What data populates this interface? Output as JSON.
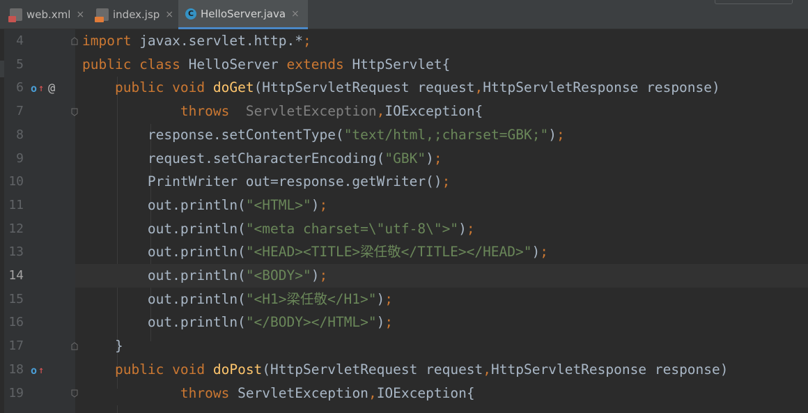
{
  "tabs": [
    {
      "label": "web.xml",
      "icon": "xml-file-icon",
      "active": false
    },
    {
      "label": "index.jsp",
      "icon": "jsp-file-icon",
      "active": false
    },
    {
      "label": "HelloServer.java",
      "icon": "java-class-icon",
      "icon_glyph": "C",
      "active": true
    }
  ],
  "close_glyph": "×",
  "gutter_icons": {
    "override": "o",
    "up_arrow": "↑",
    "annotation": "@"
  },
  "lines": [
    {
      "num": "4",
      "tokens": [
        [
          "kw",
          "import"
        ],
        [
          "t",
          " javax.servlet.http.*"
        ],
        [
          "kw",
          ";"
        ]
      ]
    },
    {
      "num": "5",
      "tokens": [
        [
          "kw",
          "public class"
        ],
        [
          "t",
          " HelloServer "
        ],
        [
          "kw",
          "extends"
        ],
        [
          "t",
          " HttpServlet{"
        ]
      ]
    },
    {
      "num": "6",
      "tokens": [
        [
          "t",
          "    "
        ],
        [
          "kw",
          "public void"
        ],
        [
          "t",
          " "
        ],
        [
          "fn",
          "doGet"
        ],
        [
          "t",
          "(HttpServletRequest request"
        ],
        [
          "kw",
          ","
        ],
        [
          "t",
          "HttpServletResponse response)"
        ]
      ]
    },
    {
      "num": "7",
      "tokens": [
        [
          "t",
          "            "
        ],
        [
          "kw",
          "throws"
        ],
        [
          "t",
          "  "
        ],
        [
          "dim",
          "ServletException"
        ],
        [
          "kw",
          ","
        ],
        [
          "t",
          "IOException{"
        ]
      ]
    },
    {
      "num": "8",
      "tokens": [
        [
          "t",
          "        response.setContentType("
        ],
        [
          "str",
          "\"text/html,;charset=GBK;\""
        ],
        [
          "t",
          ")"
        ],
        [
          "kw",
          ";"
        ]
      ]
    },
    {
      "num": "9",
      "tokens": [
        [
          "t",
          "        request.setCharacterEncoding("
        ],
        [
          "str",
          "\"GBK\""
        ],
        [
          "t",
          ")"
        ],
        [
          "kw",
          ";"
        ]
      ]
    },
    {
      "num": "10",
      "tokens": [
        [
          "t",
          "        PrintWriter out=response.getWriter()"
        ],
        [
          "kw",
          ";"
        ]
      ]
    },
    {
      "num": "11",
      "tokens": [
        [
          "t",
          "        out.println("
        ],
        [
          "str",
          "\"<HTML>\""
        ],
        [
          "t",
          ")"
        ],
        [
          "kw",
          ";"
        ]
      ]
    },
    {
      "num": "12",
      "tokens": [
        [
          "t",
          "        out.println("
        ],
        [
          "str",
          "\"<meta charset=\\\"utf-8\\\">\""
        ],
        [
          "t",
          ")"
        ],
        [
          "kw",
          ";"
        ]
      ]
    },
    {
      "num": "13",
      "tokens": [
        [
          "t",
          "        out.println("
        ],
        [
          "str",
          "\"<HEAD><TITLE>梁任敬</TITLE></HEAD>\""
        ],
        [
          "t",
          ")"
        ],
        [
          "kw",
          ";"
        ]
      ]
    },
    {
      "num": "14",
      "tokens": [
        [
          "t",
          "        out.println("
        ],
        [
          "str",
          "\"<BODY>\""
        ],
        [
          "t",
          ")"
        ],
        [
          "kw",
          ";"
        ]
      ],
      "current": true
    },
    {
      "num": "15",
      "tokens": [
        [
          "t",
          "        out.println("
        ],
        [
          "str",
          "\"<H1>梁任敬</H1>\""
        ],
        [
          "t",
          ")"
        ],
        [
          "kw",
          ";"
        ]
      ]
    },
    {
      "num": "16",
      "tokens": [
        [
          "t",
          "        out.println("
        ],
        [
          "str",
          "\"</BODY></HTML>\""
        ],
        [
          "t",
          ")"
        ],
        [
          "kw",
          ";"
        ]
      ]
    },
    {
      "num": "17",
      "tokens": [
        [
          "t",
          "    }"
        ]
      ]
    },
    {
      "num": "18",
      "tokens": [
        [
          "t",
          "    "
        ],
        [
          "kw",
          "public void"
        ],
        [
          "t",
          " "
        ],
        [
          "fn",
          "doPost"
        ],
        [
          "t",
          "(HttpServletRequest request"
        ],
        [
          "kw",
          ","
        ],
        [
          "t",
          "HttpServletResponse response)"
        ]
      ]
    },
    {
      "num": "19",
      "tokens": [
        [
          "t",
          "            "
        ],
        [
          "kw",
          "throws"
        ],
        [
          "t",
          " ServletException"
        ],
        [
          "kw",
          ","
        ],
        [
          "t",
          "IOException{"
        ]
      ]
    }
  ]
}
